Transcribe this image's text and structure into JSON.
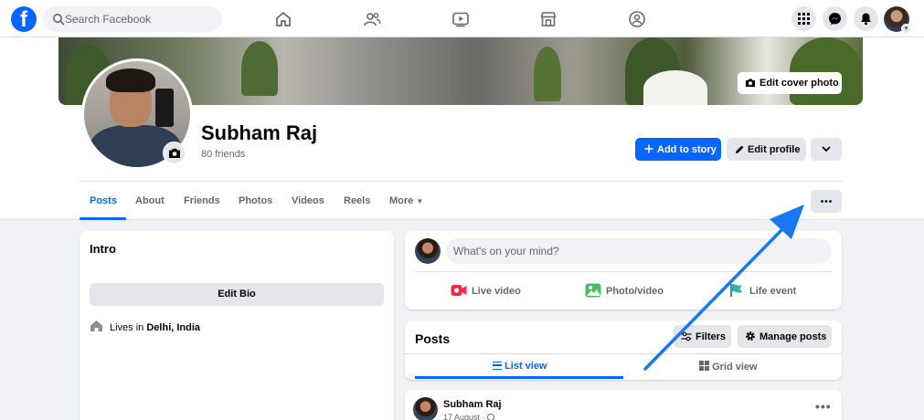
{
  "topbar": {
    "logo": "f",
    "search_placeholder": "Search Facebook",
    "nav_icons": [
      "home-icon",
      "friends-icon",
      "watch-icon",
      "marketplace-icon",
      "groups-icon"
    ],
    "right_icons": [
      "menu-grid-icon",
      "messenger-icon",
      "notifications-icon"
    ]
  },
  "cover": {
    "edit_cover_label": "Edit cover photo"
  },
  "profile": {
    "name": "Subham Raj",
    "friends": "80 friends",
    "add_story_label": "Add to story",
    "edit_profile_label": "Edit profile"
  },
  "tabs": [
    {
      "label": "Posts"
    },
    {
      "label": "About"
    },
    {
      "label": "Friends"
    },
    {
      "label": "Photos"
    },
    {
      "label": "Videos"
    },
    {
      "label": "Reels"
    },
    {
      "label": "More"
    }
  ],
  "intro": {
    "title": "Intro",
    "edit_bio_label": "Edit Bio",
    "lives_prefix": "Lives in",
    "lives_place": "Delhi, India"
  },
  "composer": {
    "placeholder": "What's on your mind?",
    "live_video": "Live video",
    "photo_video": "Photo/video",
    "life_event": "Life event"
  },
  "posts": {
    "title": "Posts",
    "filters_label": "Filters",
    "manage_label": "Manage posts",
    "list_view": "List view",
    "grid_view": "Grid view"
  },
  "post": {
    "author": "Subham Raj",
    "date": "17 August ·"
  },
  "colors": {
    "brand": "#0866ff",
    "annotation_arrow": "#1877f2"
  }
}
